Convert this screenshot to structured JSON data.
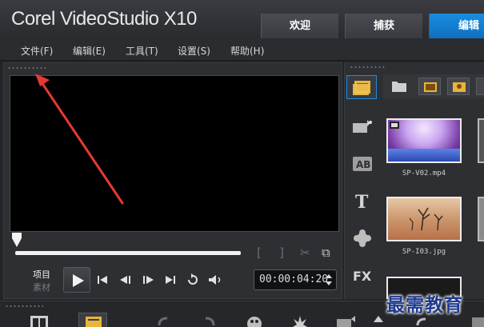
{
  "app": {
    "brand": "Corel VideoStudio X10",
    "tabs": [
      {
        "label": "欢迎",
        "active": false
      },
      {
        "label": "捕获",
        "active": false
      },
      {
        "label": "编辑",
        "active": true
      }
    ]
  },
  "menu": {
    "items": [
      "文件(F)",
      "编辑(E)",
      "工具(T)",
      "设置(S)",
      "帮助(H)"
    ]
  },
  "player": {
    "mode_project": "项目",
    "mode_clip": "素材",
    "timecode": "00:00:04:20",
    "scrub_position": 0
  },
  "library": {
    "items": [
      {
        "label": "SP-V02.mp4",
        "kind": "video"
      },
      {
        "label": "SP-I03.jpg",
        "kind": "photo"
      }
    ],
    "side_icons": [
      "media-icon",
      "instant-project-icon",
      "transition-icon",
      "title-icon",
      "graphic-icon",
      "filter-icon"
    ]
  },
  "watermark": "最需教育",
  "colors": {
    "active_tab": "#1a8de0",
    "annotation_arrow": "#e53935",
    "watermark": "#1f3a8f"
  }
}
